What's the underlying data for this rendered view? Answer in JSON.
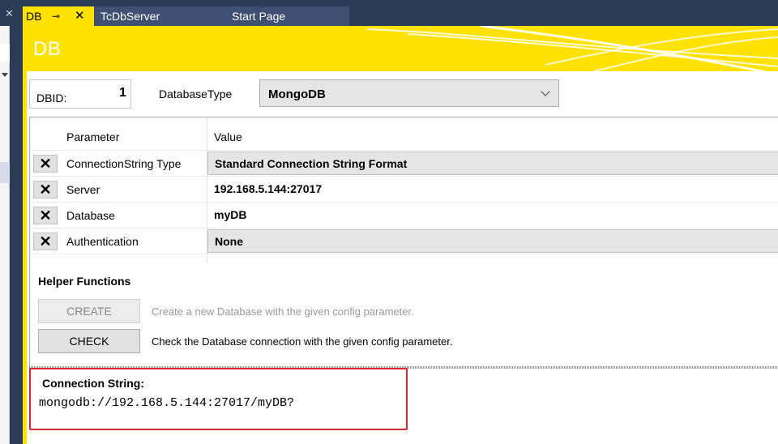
{
  "tabs": {
    "active": {
      "label": "DB",
      "pin_icon": "pin-icon",
      "close_icon": "close-icon"
    },
    "tab2": {
      "label": "TcDbServer"
    },
    "tab3": {
      "label": "Start Page"
    }
  },
  "banner": {
    "title": "DB"
  },
  "dbid": {
    "label": "DBID:",
    "value": "1"
  },
  "database_type": {
    "label": "DatabaseType",
    "value": "MongoDB"
  },
  "grid": {
    "headers": {
      "parameter": "Parameter",
      "value": "Value"
    },
    "rows": [
      {
        "name": "ConnectionString Type",
        "value": "Standard Connection String Format"
      },
      {
        "name": "Server",
        "value": "192.168.5.144:27017"
      },
      {
        "name": "Database",
        "value": "myDB"
      },
      {
        "name": "Authentication",
        "value": "None"
      }
    ]
  },
  "helper": {
    "title": "Helper Functions",
    "create": {
      "label": "CREATE",
      "description": "Create a new Database with the given config parameter."
    },
    "check": {
      "label": "CHECK",
      "description": "Check the Database connection with the given config parameter."
    }
  },
  "connection": {
    "label": "Connection String:",
    "value": "mongodb://192.168.5.144:27017/myDB?"
  },
  "colors": {
    "accent": "#ffe200",
    "frame": "#2b3c57",
    "highlight": "#e0242c"
  }
}
